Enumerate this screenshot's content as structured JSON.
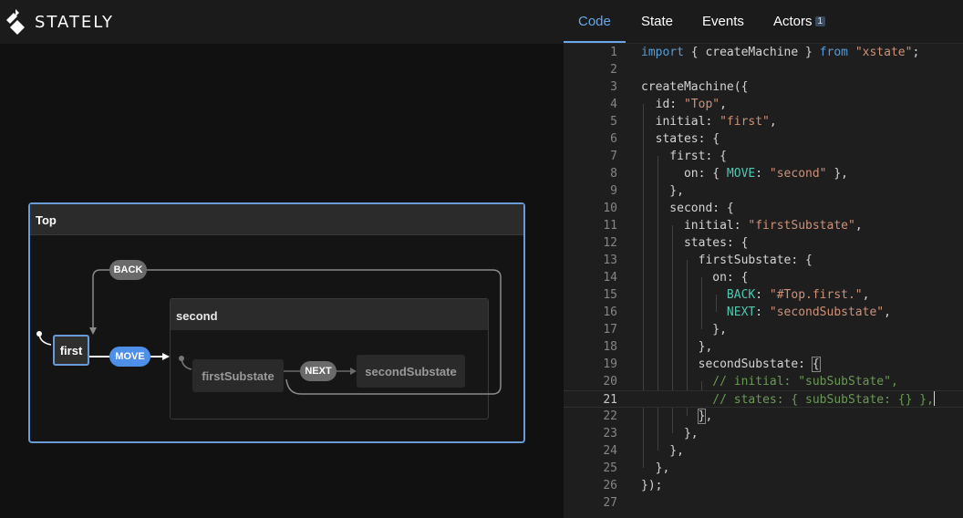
{
  "brand": {
    "name": "STATELY",
    "logo_icon": "stately-logo-icon"
  },
  "tabs": [
    {
      "label": "Code",
      "active": true
    },
    {
      "label": "State",
      "active": false
    },
    {
      "label": "Events",
      "active": false
    },
    {
      "label": "Actors",
      "active": false,
      "badge": "1"
    }
  ],
  "canvas": {
    "top_state": "Top",
    "first_state": "first",
    "second_state": "second",
    "sub_first": "firstSubstate",
    "sub_second": "secondSubstate",
    "events": {
      "back": "BACK",
      "move": "MOVE",
      "next": "NEXT"
    }
  },
  "editor": {
    "current_line": 21,
    "line_numbers": [
      "1",
      "2",
      "3",
      "4",
      "5",
      "6",
      "7",
      "8",
      "9",
      "10",
      "11",
      "12",
      "13",
      "14",
      "15",
      "16",
      "17",
      "18",
      "19",
      "20",
      "21",
      "22",
      "23",
      "24",
      "25",
      "26",
      "27"
    ],
    "lines": [
      [
        [
          "k",
          "import"
        ],
        [
          "p",
          " { createMachine } "
        ],
        [
          "k",
          "from"
        ],
        [
          "p",
          " "
        ],
        [
          "s",
          "\"xstate\""
        ],
        [
          "p",
          ";"
        ]
      ],
      [],
      [
        [
          "p",
          "createMachine({"
        ]
      ],
      [
        [
          "p",
          "  id: "
        ],
        [
          "s",
          "\"Top\""
        ],
        [
          "p",
          ","
        ]
      ],
      [
        [
          "p",
          "  initial: "
        ],
        [
          "s",
          "\"first\""
        ],
        [
          "p",
          ","
        ]
      ],
      [
        [
          "p",
          "  states: {"
        ]
      ],
      [
        [
          "p",
          "    first: {"
        ]
      ],
      [
        [
          "p",
          "      on: { "
        ],
        [
          "t",
          "MOVE"
        ],
        [
          "p",
          ": "
        ],
        [
          "s",
          "\"second\""
        ],
        [
          "p",
          " },"
        ]
      ],
      [
        [
          "p",
          "    },"
        ]
      ],
      [
        [
          "p",
          "    second: {"
        ]
      ],
      [
        [
          "p",
          "      initial: "
        ],
        [
          "s",
          "\"firstSubstate\""
        ],
        [
          "p",
          ","
        ]
      ],
      [
        [
          "p",
          "      states: {"
        ]
      ],
      [
        [
          "p",
          "        firstSubstate: {"
        ]
      ],
      [
        [
          "p",
          "          on: {"
        ]
      ],
      [
        [
          "p",
          "            "
        ],
        [
          "t",
          "BACK"
        ],
        [
          "p",
          ": "
        ],
        [
          "s",
          "\"#Top.first.\""
        ],
        [
          "p",
          ","
        ]
      ],
      [
        [
          "p",
          "            "
        ],
        [
          "t",
          "NEXT"
        ],
        [
          "p",
          ": "
        ],
        [
          "s",
          "\"secondSubstate\""
        ],
        [
          "p",
          ","
        ]
      ],
      [
        [
          "p",
          "          },"
        ]
      ],
      [
        [
          "p",
          "        },"
        ]
      ],
      [
        [
          "p",
          "        secondSubstate: "
        ],
        [
          "br",
          "{"
        ]
      ],
      [
        [
          "p",
          "          "
        ],
        [
          "c",
          "// initial: \"subSubState\","
        ]
      ],
      [
        [
          "p",
          "          "
        ],
        [
          "c",
          "// states: { subSubState: {} },"
        ]
      ],
      [
        [
          "p",
          "        "
        ],
        [
          "br",
          "}"
        ],
        [
          "p",
          ","
        ]
      ],
      [
        [
          "p",
          "      },"
        ]
      ],
      [
        [
          "p",
          "    },"
        ]
      ],
      [
        [
          "p",
          "  },"
        ]
      ],
      [
        [
          "p",
          "});"
        ]
      ],
      []
    ]
  },
  "colors": {
    "accent": "#6aa6e8",
    "move_event": "#4e8fe8",
    "state_border": "#6b9bd6"
  }
}
